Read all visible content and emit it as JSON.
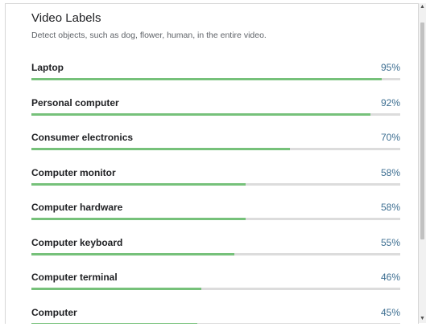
{
  "header": {
    "title": "Video Labels",
    "subtitle": "Detect objects, such as dog, flower, human, in the entire video."
  },
  "labels": [
    {
      "name": "Laptop",
      "percent_text": "95%",
      "confidence": 0.95
    },
    {
      "name": "Personal computer",
      "percent_text": "92%",
      "confidence": 0.92
    },
    {
      "name": "Consumer electronics",
      "percent_text": "70%",
      "confidence": 0.7
    },
    {
      "name": "Computer monitor",
      "percent_text": "58%",
      "confidence": 0.58
    },
    {
      "name": "Computer hardware",
      "percent_text": "58%",
      "confidence": 0.58
    },
    {
      "name": "Computer keyboard",
      "percent_text": "55%",
      "confidence": 0.55
    },
    {
      "name": "Computer terminal",
      "percent_text": "46%",
      "confidence": 0.46
    },
    {
      "name": "Computer",
      "percent_text": "45%",
      "confidence": 0.45
    }
  ],
  "colors": {
    "bar_fill": "#76c17a",
    "bar_track": "#dcdcdc",
    "percent_text": "#3c6e91"
  },
  "scrollbar": {
    "up_icon": "triangle-up-icon",
    "down_icon": "triangle-down-icon"
  }
}
